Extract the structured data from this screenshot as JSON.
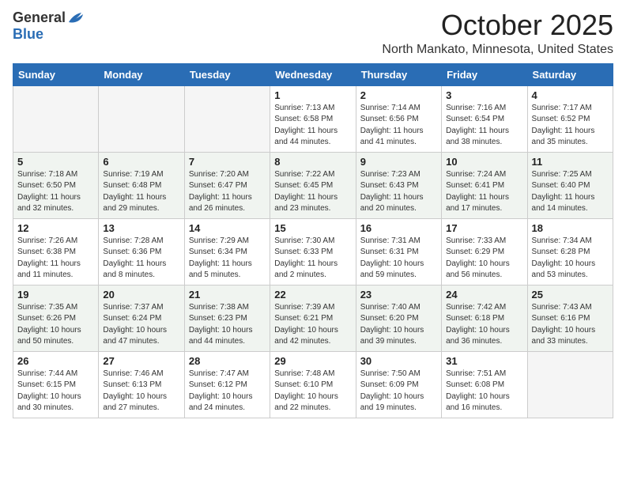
{
  "logo": {
    "general": "General",
    "blue": "Blue"
  },
  "header": {
    "month": "October 2025",
    "location": "North Mankato, Minnesota, United States"
  },
  "days_of_week": [
    "Sunday",
    "Monday",
    "Tuesday",
    "Wednesday",
    "Thursday",
    "Friday",
    "Saturday"
  ],
  "weeks": [
    [
      {
        "day": "",
        "info": ""
      },
      {
        "day": "",
        "info": ""
      },
      {
        "day": "",
        "info": ""
      },
      {
        "day": "1",
        "info": "Sunrise: 7:13 AM\nSunset: 6:58 PM\nDaylight: 11 hours\nand 44 minutes."
      },
      {
        "day": "2",
        "info": "Sunrise: 7:14 AM\nSunset: 6:56 PM\nDaylight: 11 hours\nand 41 minutes."
      },
      {
        "day": "3",
        "info": "Sunrise: 7:16 AM\nSunset: 6:54 PM\nDaylight: 11 hours\nand 38 minutes."
      },
      {
        "day": "4",
        "info": "Sunrise: 7:17 AM\nSunset: 6:52 PM\nDaylight: 11 hours\nand 35 minutes."
      }
    ],
    [
      {
        "day": "5",
        "info": "Sunrise: 7:18 AM\nSunset: 6:50 PM\nDaylight: 11 hours\nand 32 minutes."
      },
      {
        "day": "6",
        "info": "Sunrise: 7:19 AM\nSunset: 6:48 PM\nDaylight: 11 hours\nand 29 minutes."
      },
      {
        "day": "7",
        "info": "Sunrise: 7:20 AM\nSunset: 6:47 PM\nDaylight: 11 hours\nand 26 minutes."
      },
      {
        "day": "8",
        "info": "Sunrise: 7:22 AM\nSunset: 6:45 PM\nDaylight: 11 hours\nand 23 minutes."
      },
      {
        "day": "9",
        "info": "Sunrise: 7:23 AM\nSunset: 6:43 PM\nDaylight: 11 hours\nand 20 minutes."
      },
      {
        "day": "10",
        "info": "Sunrise: 7:24 AM\nSunset: 6:41 PM\nDaylight: 11 hours\nand 17 minutes."
      },
      {
        "day": "11",
        "info": "Sunrise: 7:25 AM\nSunset: 6:40 PM\nDaylight: 11 hours\nand 14 minutes."
      }
    ],
    [
      {
        "day": "12",
        "info": "Sunrise: 7:26 AM\nSunset: 6:38 PM\nDaylight: 11 hours\nand 11 minutes."
      },
      {
        "day": "13",
        "info": "Sunrise: 7:28 AM\nSunset: 6:36 PM\nDaylight: 11 hours\nand 8 minutes."
      },
      {
        "day": "14",
        "info": "Sunrise: 7:29 AM\nSunset: 6:34 PM\nDaylight: 11 hours\nand 5 minutes."
      },
      {
        "day": "15",
        "info": "Sunrise: 7:30 AM\nSunset: 6:33 PM\nDaylight: 11 hours\nand 2 minutes."
      },
      {
        "day": "16",
        "info": "Sunrise: 7:31 AM\nSunset: 6:31 PM\nDaylight: 10 hours\nand 59 minutes."
      },
      {
        "day": "17",
        "info": "Sunrise: 7:33 AM\nSunset: 6:29 PM\nDaylight: 10 hours\nand 56 minutes."
      },
      {
        "day": "18",
        "info": "Sunrise: 7:34 AM\nSunset: 6:28 PM\nDaylight: 10 hours\nand 53 minutes."
      }
    ],
    [
      {
        "day": "19",
        "info": "Sunrise: 7:35 AM\nSunset: 6:26 PM\nDaylight: 10 hours\nand 50 minutes."
      },
      {
        "day": "20",
        "info": "Sunrise: 7:37 AM\nSunset: 6:24 PM\nDaylight: 10 hours\nand 47 minutes."
      },
      {
        "day": "21",
        "info": "Sunrise: 7:38 AM\nSunset: 6:23 PM\nDaylight: 10 hours\nand 44 minutes."
      },
      {
        "day": "22",
        "info": "Sunrise: 7:39 AM\nSunset: 6:21 PM\nDaylight: 10 hours\nand 42 minutes."
      },
      {
        "day": "23",
        "info": "Sunrise: 7:40 AM\nSunset: 6:20 PM\nDaylight: 10 hours\nand 39 minutes."
      },
      {
        "day": "24",
        "info": "Sunrise: 7:42 AM\nSunset: 6:18 PM\nDaylight: 10 hours\nand 36 minutes."
      },
      {
        "day": "25",
        "info": "Sunrise: 7:43 AM\nSunset: 6:16 PM\nDaylight: 10 hours\nand 33 minutes."
      }
    ],
    [
      {
        "day": "26",
        "info": "Sunrise: 7:44 AM\nSunset: 6:15 PM\nDaylight: 10 hours\nand 30 minutes."
      },
      {
        "day": "27",
        "info": "Sunrise: 7:46 AM\nSunset: 6:13 PM\nDaylight: 10 hours\nand 27 minutes."
      },
      {
        "day": "28",
        "info": "Sunrise: 7:47 AM\nSunset: 6:12 PM\nDaylight: 10 hours\nand 24 minutes."
      },
      {
        "day": "29",
        "info": "Sunrise: 7:48 AM\nSunset: 6:10 PM\nDaylight: 10 hours\nand 22 minutes."
      },
      {
        "day": "30",
        "info": "Sunrise: 7:50 AM\nSunset: 6:09 PM\nDaylight: 10 hours\nand 19 minutes."
      },
      {
        "day": "31",
        "info": "Sunrise: 7:51 AM\nSunset: 6:08 PM\nDaylight: 10 hours\nand 16 minutes."
      },
      {
        "day": "",
        "info": ""
      }
    ]
  ]
}
